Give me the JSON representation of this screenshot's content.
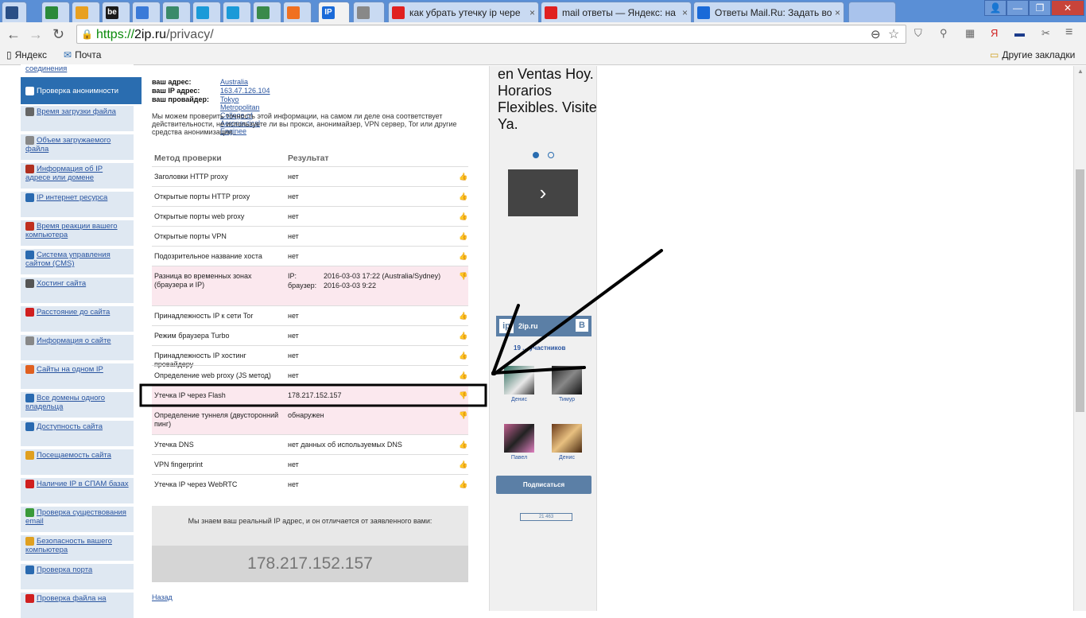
{
  "tabs": [
    {
      "title": "",
      "icon": "plus-icon",
      "color": "#2a4f86"
    },
    {
      "title": "",
      "icon": "home-icon",
      "color": "#2a8a3a"
    },
    {
      "title": "",
      "icon": "avatar-icon",
      "color": "#e8a020"
    },
    {
      "title": "",
      "icon": "behance-icon",
      "color": "#1a1a1a",
      "text": "be"
    },
    {
      "title": "",
      "icon": "sw-icon",
      "color": "#3a7ad8"
    },
    {
      "title": "",
      "icon": "briefcase-icon",
      "color": "#3a8a6a"
    },
    {
      "title": "",
      "icon": "cross-icon",
      "color": "#1a9ad8"
    },
    {
      "title": "",
      "icon": "cross-icon",
      "color": "#1a9ad8"
    },
    {
      "title": "",
      "icon": "mail-icon",
      "color": "#3a8a4a"
    },
    {
      "title": "",
      "icon": "blogger-icon",
      "color": "#f07020"
    },
    {
      "title": "",
      "icon": "ip-icon",
      "color": "#1a6ad8",
      "text": "IP",
      "active": true
    },
    {
      "title": "",
      "icon": "page-icon",
      "color": "#888"
    },
    {
      "title": "как убрать утечку ip чере",
      "icon": "yandex-icon",
      "color": "#e02020"
    },
    {
      "title": "mail ответы — Яндекс: на",
      "icon": "yandex-icon",
      "color": "#e02020"
    },
    {
      "title": "Ответы Mail.Ru: Задать во",
      "icon": "question-icon",
      "color": "#1a6ad8"
    }
  ],
  "toolbar": {
    "url_scheme": "https://",
    "url_host": "2ip.ru",
    "url_path": "/privacy/"
  },
  "bookmarks": {
    "items": [
      "Яндекс",
      "Почта"
    ],
    "other": "Другие закладки"
  },
  "sidebar": {
    "items": [
      {
        "label": "соединения",
        "icon": "connection-icon",
        "color": "#2a8a3a"
      },
      {
        "label": "Проверка анонимности",
        "icon": "user-icon",
        "color": "#ffffff",
        "active": true
      },
      {
        "label": "Время загрузки файла",
        "icon": "clock-icon",
        "color": "#666"
      },
      {
        "label": "Объем загружаемого файла",
        "icon": "box-icon",
        "color": "#888"
      },
      {
        "label": "Информация об IP адресе или домене",
        "icon": "ip-icon",
        "color": "#b03020"
      },
      {
        "label": "IP интернет ресурса",
        "icon": "globe-icon",
        "color": "#2a6ab0"
      },
      {
        "label": "Время реакции вашего компьютера",
        "icon": "refresh-icon",
        "color": "#c03020"
      },
      {
        "label": "Система управления сайтом (CMS)",
        "icon": "cms-icon",
        "color": "#2a6ab0"
      },
      {
        "label": "Хостинг сайта",
        "icon": "server-icon",
        "color": "#555"
      },
      {
        "label": "Расстояние до сайта",
        "icon": "pin-icon",
        "color": "#d02020"
      },
      {
        "label": "Информация о сайте",
        "icon": "window-icon",
        "color": "#888"
      },
      {
        "label": "Сайты на одном IP",
        "icon": "network-icon",
        "color": "#e06020"
      },
      {
        "label": "Все домены одного владельца",
        "icon": "globe-icon",
        "color": "#2a6ab0"
      },
      {
        "label": "Доступность сайта",
        "icon": "globe-icon",
        "color": "#2a6ab0"
      },
      {
        "label": "Посещаемость сайта",
        "icon": "star-icon",
        "color": "#e0a020"
      },
      {
        "label": "Наличие IP в СПАМ базах",
        "icon": "stop-icon",
        "color": "#d02020"
      },
      {
        "label": "Проверка существования email",
        "icon": "mail-icon",
        "color": "#3a9a3a"
      },
      {
        "label": "Безопасность вашего компьютера",
        "icon": "lock-icon",
        "color": "#e0a020"
      },
      {
        "label": "Проверка порта",
        "icon": "globe-icon",
        "color": "#2a6ab0"
      },
      {
        "label": "Проверка файла на",
        "icon": "bug-icon",
        "color": "#d02020"
      }
    ]
  },
  "info": {
    "address_label": "ваш адрес:",
    "address_value": "Australia",
    "ip_label": "ваш IP адрес:",
    "ip_value": "163.47.126.104",
    "provider_label": "ваш провайдер:",
    "provider_value": "Tokyo Metropolitan College of Aeronautical Enginee",
    "description": "Мы можем проверить точность этой информации, на самом ли деле она соответствует действительности, не используете ли вы прокси, анонимайзер, VPN сервер, Tor или другие средства анонимизации.."
  },
  "table": {
    "col_method": "Метод проверки",
    "col_result": "Результат",
    "rows": [
      {
        "method": "Заголовки HTTP proxy",
        "result": "нет",
        "ok": true
      },
      {
        "method": "Открытые порты HTTP proxy",
        "result": "нет",
        "ok": true
      },
      {
        "method": "Открытые порты web proxy",
        "result": "нет",
        "ok": true
      },
      {
        "method": "Открытые порты VPN",
        "result": "нет",
        "ok": true
      },
      {
        "method": "Подозрительное название хоста",
        "result": "нет",
        "ok": true
      },
      {
        "method": "Разница во временных зонах (браузера и IP)",
        "result_ip_label": "IP:",
        "result_ip": "2016-03-03 17:22 (Australia/Sydney)",
        "result_br_label": "браузер:",
        "result_br": "2016-03-03 9:22",
        "ok": false
      },
      {
        "method": "Принадлежность IP к сети Tor",
        "result": "нет",
        "ok": true
      },
      {
        "method": "Режим браузера Turbo",
        "result": "нет",
        "ok": true
      },
      {
        "method": "Принадлежность IP хостинг провайдеру",
        "result": "нет",
        "ok": true
      },
      {
        "method": "Определение web proxy (JS метод)",
        "result": "нет",
        "ok": true
      },
      {
        "method": "Утечка IP через Flash",
        "result": "178.217.152.157",
        "ok": false
      },
      {
        "method": "Определение туннеля (двусторонний пинг)",
        "result": "обнаружен",
        "ok": false
      },
      {
        "method": "Утечка DNS",
        "result": "нет данных об используемых DNS",
        "ok": true
      },
      {
        "method": "VPN fingerprint",
        "result": "нет",
        "ok": true
      },
      {
        "method": "Утечка IP через WebRTC",
        "result": "нет",
        "ok": true
      }
    ]
  },
  "real_ip": {
    "message": "Мы знаем ваш реальный IP адрес, и он отличается от заявленного вами:",
    "value": "178.217.152.157"
  },
  "back_link": "Назад",
  "ad": {
    "text": "en Ventas Hoy. Horarios Flexibles. Visite Ya.",
    "next": "›"
  },
  "vk_widget": {
    "group": "2ip.ru",
    "logo": "В",
    "members": "19 ... участников",
    "people": [
      "Денис",
      "Тимур",
      "Павел",
      "Денис"
    ],
    "subscribe": "Подписаться",
    "counter": "21 463"
  }
}
